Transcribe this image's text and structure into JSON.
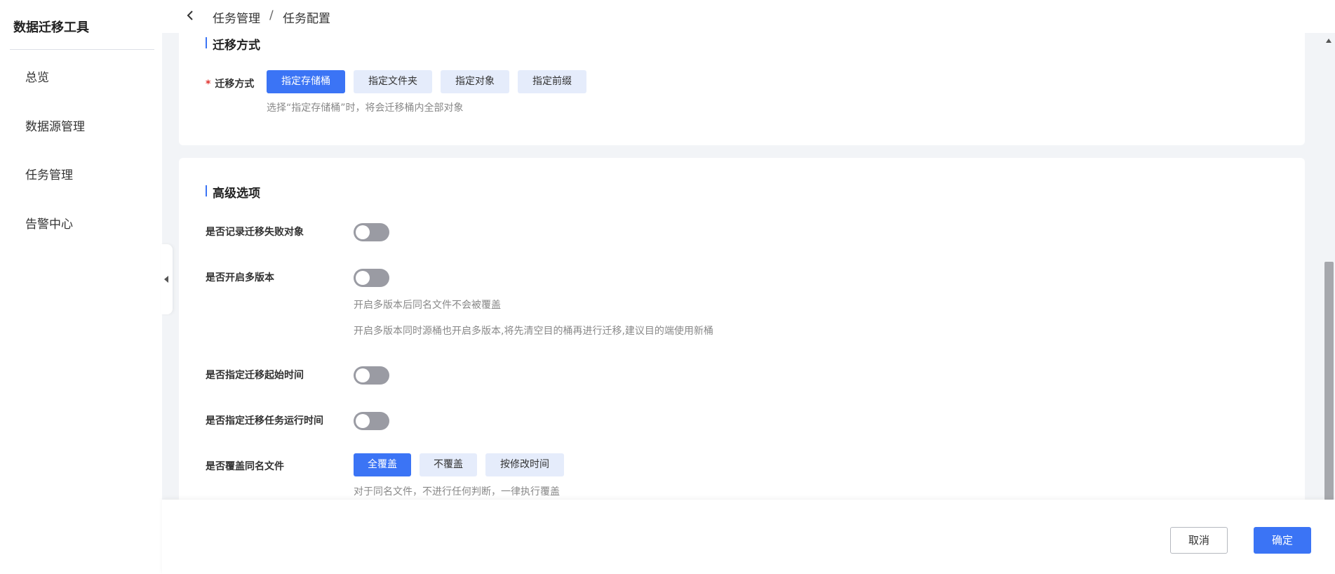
{
  "app": {
    "title": "数据迁移工具"
  },
  "sidebar": {
    "items": [
      {
        "label": "总览"
      },
      {
        "label": "数据源管理"
      },
      {
        "label": "任务管理"
      },
      {
        "label": "告警中心"
      }
    ]
  },
  "breadcrumb": {
    "items": [
      "任务管理",
      "任务配置"
    ],
    "separator": "/"
  },
  "migration": {
    "section_title": "迁移方式",
    "field_label": "迁移方式",
    "required_mark": "*",
    "options": [
      "指定存储桶",
      "指定文件夹",
      "指定对象",
      "指定前缀"
    ],
    "selected": "指定存储桶",
    "hint": "选择“指定存储桶”时，将会迁移桶内全部对象"
  },
  "advanced": {
    "section_title": "高级选项",
    "record_failed": {
      "label": "是否记录迁移失败对象",
      "enabled": false
    },
    "multi_version": {
      "label": "是否开启多版本",
      "enabled": false,
      "hint1": "开启多版本后同名文件不会被覆盖",
      "hint2": "开启多版本同时源桶也开启多版本,将先清空目的桶再进行迁移,建议目的端使用新桶"
    },
    "start_time": {
      "label": "是否指定迁移起始时间",
      "enabled": false
    },
    "run_time": {
      "label": "是否指定迁移任务运行时间",
      "enabled": false
    },
    "overwrite": {
      "label": "是否覆盖同名文件",
      "options": [
        "全覆盖",
        "不覆盖",
        "按修改时间"
      ],
      "selected": "全覆盖",
      "hint": "对于同名文件，不进行任何判断，一律执行覆盖"
    }
  },
  "footer": {
    "cancel_label": "取消",
    "confirm_label": "确定"
  },
  "colors": {
    "accent": "#3b74f5",
    "toggle_off": "#9a9ba3",
    "required": "#e0322d"
  },
  "icons": {
    "back": "chevron-left-icon",
    "collapse": "caret-left-icon",
    "scroll_up": "caret-up-icon"
  }
}
